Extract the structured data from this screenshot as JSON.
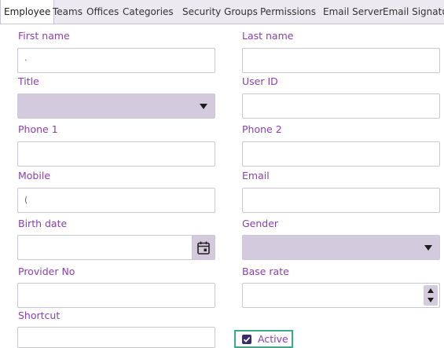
{
  "tabs": [
    {
      "label": "Employee",
      "active": true
    },
    {
      "label": "Teams"
    },
    {
      "label": "Offices"
    },
    {
      "label": "Categories"
    },
    {
      "label": "Security Groups"
    },
    {
      "label": "Permissions"
    },
    {
      "label": "Email Server"
    },
    {
      "label": "Email Signature"
    }
  ],
  "form": {
    "first_name": {
      "label": "First name",
      "value": "·"
    },
    "last_name": {
      "label": "Last name",
      "value": ""
    },
    "title": {
      "label": "Title",
      "value": ""
    },
    "user_id": {
      "label": "User ID",
      "value": ""
    },
    "phone1": {
      "label": "Phone 1",
      "value": ""
    },
    "phone2": {
      "label": "Phone 2",
      "value": ""
    },
    "mobile": {
      "label": "Mobile",
      "value": "("
    },
    "email": {
      "label": "Email",
      "value": ""
    },
    "birth_date": {
      "label": "Birth date",
      "value": ""
    },
    "gender": {
      "label": "Gender",
      "value": ""
    },
    "provider_no": {
      "label": "Provider No",
      "value": ""
    },
    "base_rate": {
      "label": "Base rate",
      "value": ""
    },
    "shortcut": {
      "label": "Shortcut",
      "value": ""
    },
    "active": {
      "label": "Active",
      "checked": true
    }
  },
  "colors": {
    "accent": "#8a3fb0",
    "select_bg": "#d3cade",
    "focus": "#3aaa8a",
    "checkbox": "#3a2c6b"
  },
  "icons": {
    "calendar": "calendar-icon",
    "dropdown": "chevron-down-icon"
  }
}
